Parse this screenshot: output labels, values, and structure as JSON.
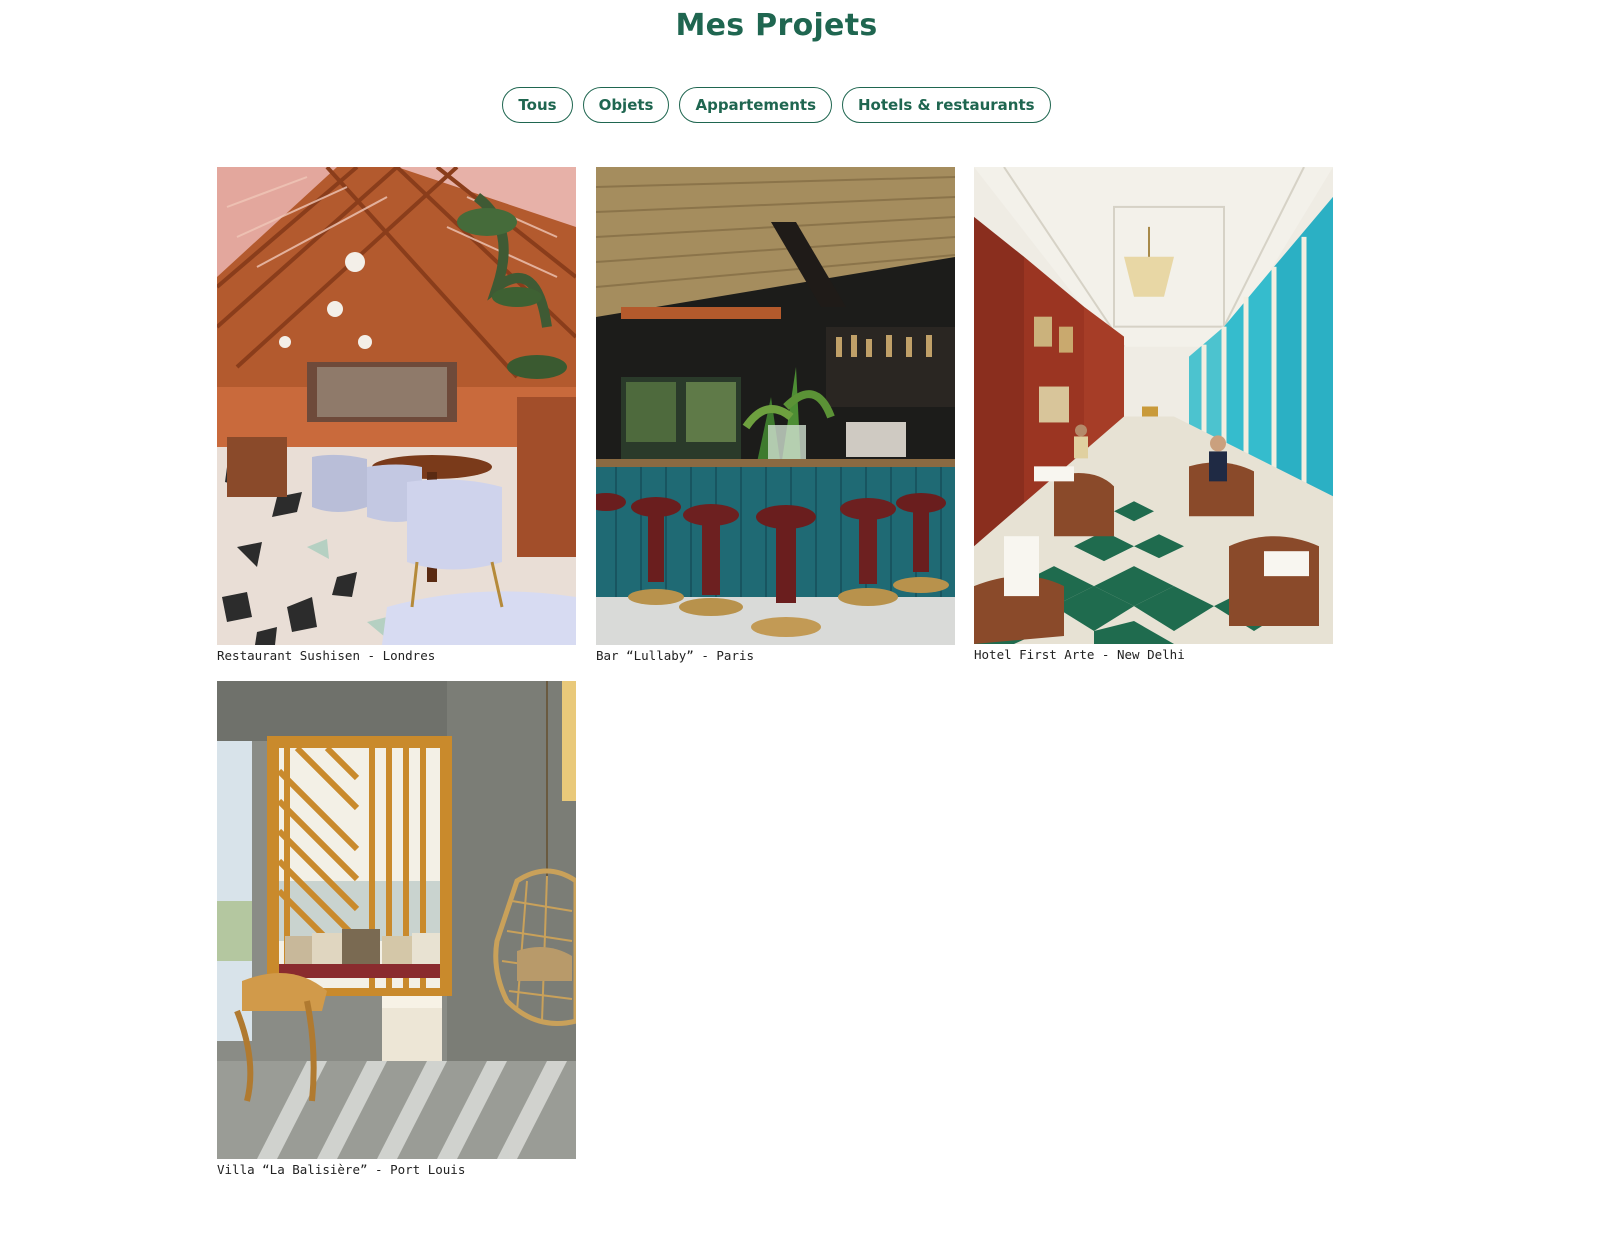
{
  "header": {
    "title": "Mes Projets"
  },
  "filters": [
    {
      "label": "Tous"
    },
    {
      "label": "Objets"
    },
    {
      "label": "Appartements"
    },
    {
      "label": "Hotels & restaurants"
    }
  ],
  "projects": [
    {
      "caption": "Restaurant Sushisen - Londres"
    },
    {
      "caption": "Bar “Lullaby” - Paris"
    },
    {
      "caption": "Hotel First Arte - New Delhi"
    },
    {
      "caption": "Villa “La Balisière” - Port Louis"
    }
  ],
  "colors": {
    "accent": "#1f6650",
    "caption_text": "#222222",
    "background": "#ffffff"
  }
}
